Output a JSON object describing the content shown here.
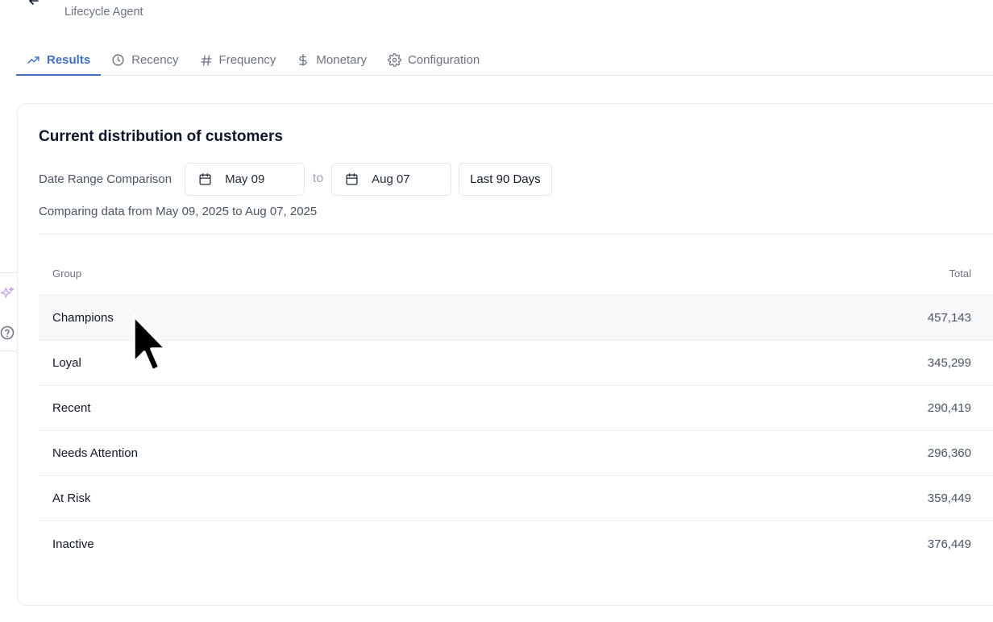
{
  "header": {
    "subtitle": "Lifecycle Agent"
  },
  "tabs": [
    {
      "label": "Results",
      "icon": "trending-up-icon",
      "active": true
    },
    {
      "label": "Recency",
      "icon": "clock-icon",
      "active": false
    },
    {
      "label": "Frequency",
      "icon": "hash-icon",
      "active": false
    },
    {
      "label": "Monetary",
      "icon": "dollar-icon",
      "active": false
    },
    {
      "label": "Configuration",
      "icon": "gear-icon",
      "active": false
    }
  ],
  "card": {
    "title": "Current distribution of customers",
    "range_label": "Date Range Comparison",
    "start_date": "May 09",
    "to_label": "to",
    "end_date": "Aug 07",
    "preset": "Last 90 Days",
    "comparing_text": "Comparing data from May 09, 2025 to Aug 07, 2025"
  },
  "table": {
    "columns": [
      "Group",
      "Total"
    ],
    "rows": [
      {
        "group": "Champions",
        "total": "457,143"
      },
      {
        "group": "Loyal",
        "total": "345,299"
      },
      {
        "group": "Recent",
        "total": "290,419"
      },
      {
        "group": "Needs Attention",
        "total": "296,360"
      },
      {
        "group": "At Risk",
        "total": "359,449"
      },
      {
        "group": "Inactive",
        "total": "376,449"
      }
    ],
    "hovered_row": 0
  },
  "colors": {
    "accent": "#3f6fc4",
    "sparkle": "#c4a6e6",
    "border": "#e5e7eb"
  }
}
